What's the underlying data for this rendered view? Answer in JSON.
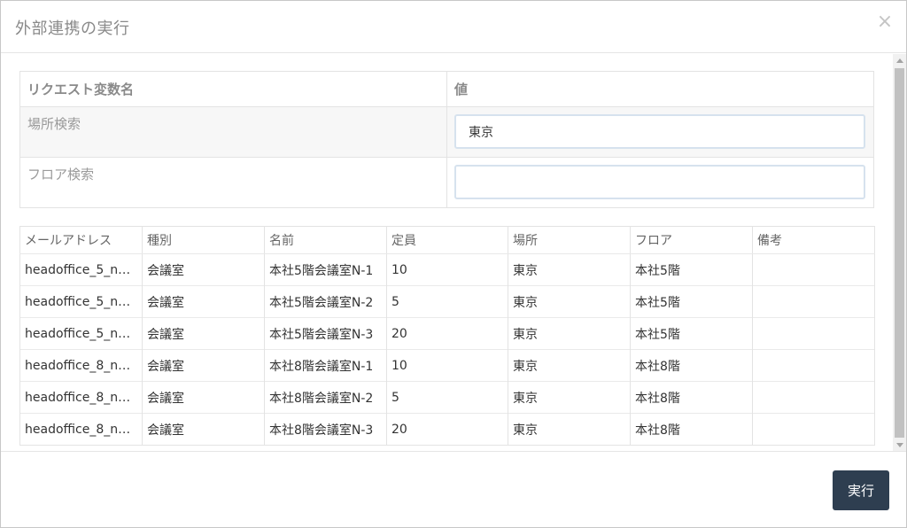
{
  "dialog": {
    "title": "外部連携の実行",
    "close_glyph": "×"
  },
  "request_table": {
    "headers": [
      "リクエスト変数名",
      "値"
    ],
    "rows": [
      {
        "label": "場所検索",
        "value": "東京"
      },
      {
        "label": "フロア検索",
        "value": ""
      }
    ]
  },
  "results_table": {
    "headers": [
      "メールアドレス",
      "種別",
      "名前",
      "定員",
      "場所",
      "フロア",
      "備考"
    ],
    "rows": [
      [
        "headoffice_5_n…",
        "会議室",
        "本社5階会議室N-1",
        "10",
        "東京",
        "本社5階",
        ""
      ],
      [
        "headoffice_5_n…",
        "会議室",
        "本社5階会議室N-2",
        "5",
        "東京",
        "本社5階",
        ""
      ],
      [
        "headoffice_5_n…",
        "会議室",
        "本社5階会議室N-3",
        "20",
        "東京",
        "本社5階",
        ""
      ],
      [
        "headoffice_8_n…",
        "会議室",
        "本社8階会議室N-1",
        "10",
        "東京",
        "本社8階",
        ""
      ],
      [
        "headoffice_8_n…",
        "会議室",
        "本社8階会議室N-2",
        "5",
        "東京",
        "本社8階",
        ""
      ],
      [
        "headoffice_8_n…",
        "会議室",
        "本社8階会議室N-3",
        "20",
        "東京",
        "本社8階",
        ""
      ]
    ]
  },
  "footer": {
    "execute_label": "実行"
  },
  "colors": {
    "execute_button": "#2e3e50",
    "title_text": "#8a8a8a"
  }
}
